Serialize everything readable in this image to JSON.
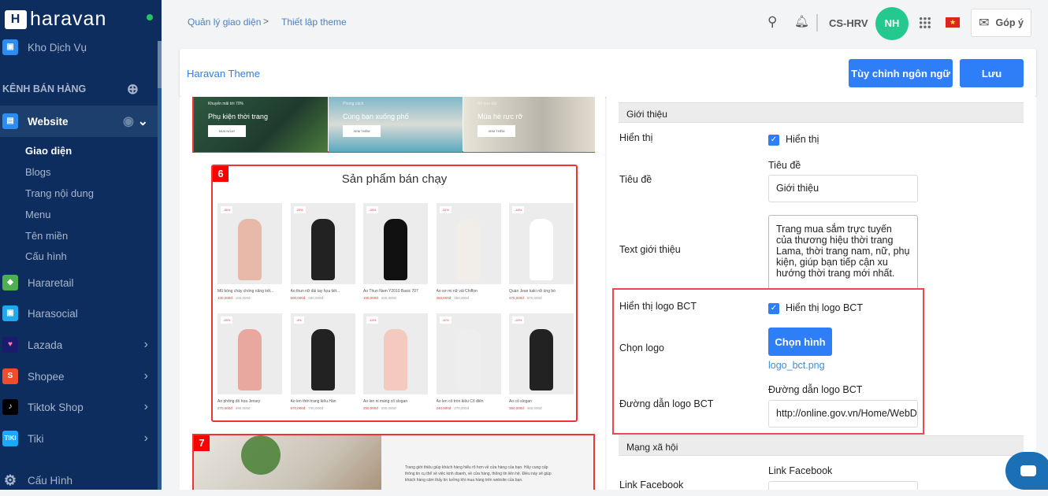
{
  "sidebar": {
    "brand": "haravan",
    "kho_dich_vu": "Kho Dịch Vụ",
    "section_title": "KÊNH BÁN HÀNG",
    "website": "Website",
    "website_sub": [
      "Giao diện",
      "Blogs",
      "Trang nội dung",
      "Menu",
      "Tên miền",
      "Cấu hình"
    ],
    "channels": [
      "Hararetail",
      "Harasocial",
      "Lazada",
      "Shopee",
      "Tiktok Shop",
      "Tiki"
    ],
    "settings": "Cấu Hình"
  },
  "topbar": {
    "breadcrumb": [
      "Quản lý giao diện",
      "Thiết lập theme"
    ],
    "separator": ">",
    "store": "CS-HRV",
    "avatar": "NH",
    "feedback": "Góp ý"
  },
  "header": {
    "title": "Haravan Theme",
    "customize_language": "Tùy chỉnh ngôn ngữ",
    "save": "Lưu"
  },
  "preview": {
    "banners": [
      {
        "tag": "Khuyến mãi tới 70%",
        "title": "Phụ kiện thời trang",
        "button": "MUA NGAY"
      },
      {
        "tag": "Phong cách",
        "title": "Cùng bạn xuống phố",
        "button": "XEM THÊM"
      },
      {
        "tag": "Bộ sưu tập",
        "title": "Mùa hè rực rỡ",
        "button": "XEM THÊM"
      }
    ],
    "section6_badge": "6",
    "section6_title": "Sản phẩm bán chạy",
    "products": [
      {
        "name": "Mũ bóng chày chống nắng kết...",
        "discount": "-35%",
        "price": "100,000đ",
        "old": "150,000đ"
      },
      {
        "name": "Áo thun nữ dài tay họa tiết...",
        "discount": "-25%",
        "price": "500,000đ",
        "old": "650,000đ"
      },
      {
        "name": "Áo Thun Nam Y2010 Basic 707",
        "discount": "-25%",
        "price": "150,000đ",
        "old": "200,000đ"
      },
      {
        "name": "Áo sơ mi nữ vải Chiffon",
        "discount": "-22%",
        "price": "350,000đ",
        "old": "450,000đ"
      },
      {
        "name": "Quần Jean kaki nữ ống bó",
        "discount": "-18%",
        "price": "470,000đ",
        "old": "570,000đ"
      },
      {
        "name": "Áo phông đồ họa Jersey",
        "discount": "-45%",
        "price": "270,000đ",
        "old": "490,000đ"
      },
      {
        "name": "Áo len thời trang kiểu Hàn",
        "discount": "-4%",
        "price": "670,000đ",
        "old": "700,000đ"
      },
      {
        "name": "Áo len nỉ màng cổ slogan",
        "discount": "-14%",
        "price": "250,000đ",
        "old": "290,000đ"
      },
      {
        "name": "Áo len cổ tròn kiểu Cổ điển",
        "discount": "-11%",
        "price": "240,000đ",
        "old": "270,000đ"
      },
      {
        "name": "Áo có slogan",
        "discount": "-20%",
        "price": "360,000đ",
        "old": "460,000đ"
      }
    ],
    "section7_badge": "7",
    "section7_text": "Trang giới thiệu giúp khách hàng hiểu rõ hơn về cửa hàng của bạn. Hãy cung cấp thông tin cụ thể về việc kinh doanh, về cửa hàng, thông tin liên hệ. Điều này sẽ giúp khách hàng cảm thấy tin tưởng khi mua hàng trên website của bạn."
  },
  "form": {
    "section_intro": "Giới thiệu",
    "show_label": "Hiển thị",
    "show_checkbox": "Hiển thị",
    "title_label": "Tiêu đề",
    "title_field_label": "Tiêu đề",
    "title_value": "Giới thiệu",
    "text_label": "Text giới thiệu",
    "text_value": "Trang mua sắm trực tuyến của thương hiệu thời trang Lama, thời trang nam, nữ, phụ kiện, giúp bạn tiếp cận xu hướng thời trang mới nhất.",
    "bct_show_label": "Hiển thị logo BCT",
    "bct_show_checkbox": "Hiển thị logo BCT",
    "choose_logo_label": "Chọn logo",
    "choose_image": "Chọn hình",
    "logo_file": "logo_bct.png",
    "bct_url_label": "Đường dẫn logo BCT",
    "bct_url_field_label": "Đường dẫn logo BCT",
    "bct_url_value": "http://online.gov.vn/Home/WebDetails",
    "section_social": "Mạng xã hội",
    "facebook_label": "Link Facebook",
    "facebook_field_label": "Link Facebook"
  }
}
